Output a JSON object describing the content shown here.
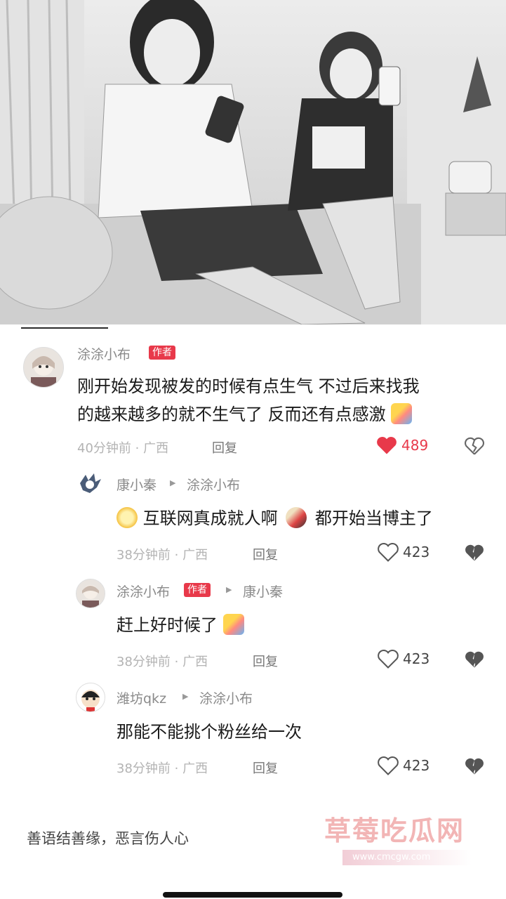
{
  "comments": [
    {
      "author": "涂涂小布",
      "badge": "作者",
      "text_line1": "刚开始发现被发的时候有点生气 不过后来找我",
      "text_line2": "的越来越多的就不生气了 反而还有点感激",
      "time_location": "40分钟前 · 广西",
      "reply_label": "回复",
      "likes": "489",
      "liked": true
    },
    {
      "author": "康小秦",
      "reply_to": "涂涂小布",
      "text_a": "互联网真成就人啊",
      "text_b": "都开始当博主了",
      "time_location": "38分钟前 · 广西",
      "reply_label": "回复",
      "likes": "423"
    },
    {
      "author": "涂涂小布",
      "badge": "作者",
      "reply_to": "康小秦",
      "text": "赶上好时候了",
      "time_location": "38分钟前 · 广西",
      "reply_label": "回复",
      "likes": "423"
    },
    {
      "author": "潍坊qkz",
      "reply_to": "涂涂小布",
      "text": "那能不能挑个粉丝给一次",
      "time_location": "38分钟前 · 广西",
      "reply_label": "回复",
      "likes": "423"
    }
  ],
  "footer": {
    "text": "善语结善缘，恶言伤人心"
  },
  "watermark": {
    "title": "草莓吃瓜网",
    "url": "www.cmcgw.com"
  },
  "colors": {
    "accent": "#e8394a",
    "like_red": "#e8394a"
  }
}
